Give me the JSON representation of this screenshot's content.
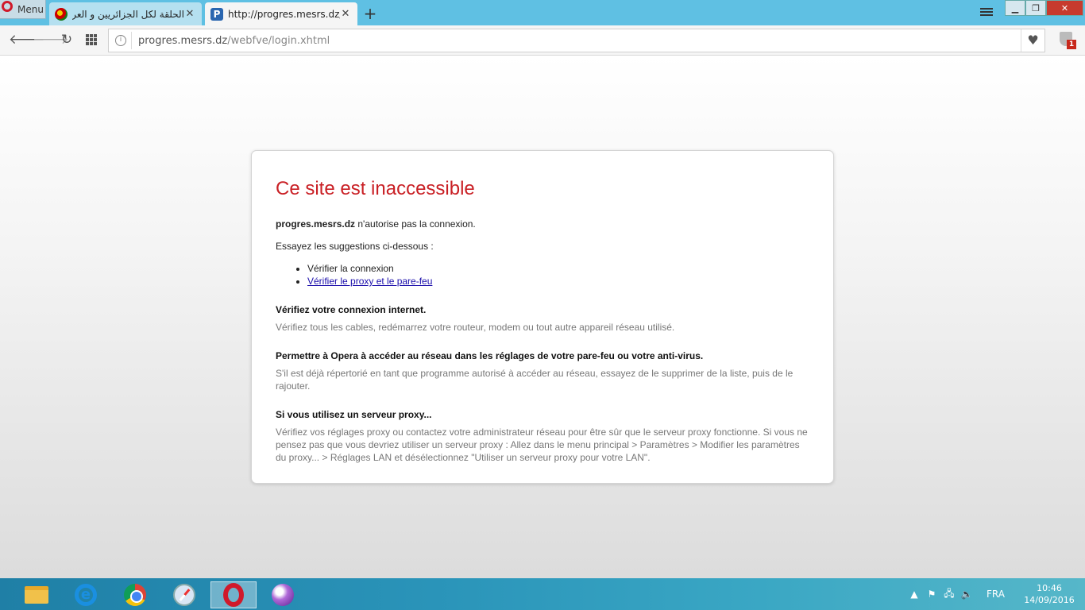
{
  "browser": {
    "menu_label": "Menu",
    "tabs": [
      {
        "title": "الحلقة لكل الجزائريين و العرب",
        "close": "✕"
      },
      {
        "title": "http://progres.mesrs.dz/webfve/login.xhtml",
        "close": "✕"
      }
    ],
    "new_tab": "+",
    "address": {
      "url_host": "progres.mesrs.dz",
      "url_path": "/webfve/login.xhtml"
    },
    "extension_badge": "1"
  },
  "error_page": {
    "title": "Ce site est inaccessible",
    "host_bold": "progres.mesrs.dz",
    "host_rest": " n'autorise pas la connexion.",
    "suggestions_intro": "Essayez les suggestions ci-dessous :",
    "suggestions": [
      "Vérifier la connexion",
      "Vérifier le proxy et le pare-feu"
    ],
    "sections": [
      {
        "heading": "Vérifiez votre connexion internet.",
        "body": "Vérifiez tous les cables, redémarrez votre routeur, modem ou tout autre appareil réseau utilisé."
      },
      {
        "heading": "Permettre à Opera à accéder au réseau dans les réglages de votre pare-feu ou votre anti-virus.",
        "body": "S'il est déjà répertorié en tant que programme autorisé à accéder au réseau, essayez de le supprimer de la liste, puis de le rajouter."
      },
      {
        "heading": "Si vous utilisez un serveur proxy...",
        "body": "Vérifiez vos réglages proxy ou contactez votre administrateur réseau pour être sûr que le serveur proxy fonctionne. Si vous ne pensez pas que vous devriez utiliser un serveur proxy : Allez dans le menu principal > Paramètres > Modifier les paramètres du proxy... > Réglages LAN et désélectionnez \"Utiliser un serveur proxy pour votre LAN\"."
      }
    ],
    "title_color": "#c91f24"
  },
  "taskbar": {
    "apps": [
      "file-explorer-icon",
      "internet-explorer-icon",
      "chrome-icon",
      "safari-icon",
      "opera-icon",
      "app-icon"
    ],
    "tray": {
      "language": "FRA",
      "time": "10:46",
      "date": "14/09/2016"
    }
  }
}
